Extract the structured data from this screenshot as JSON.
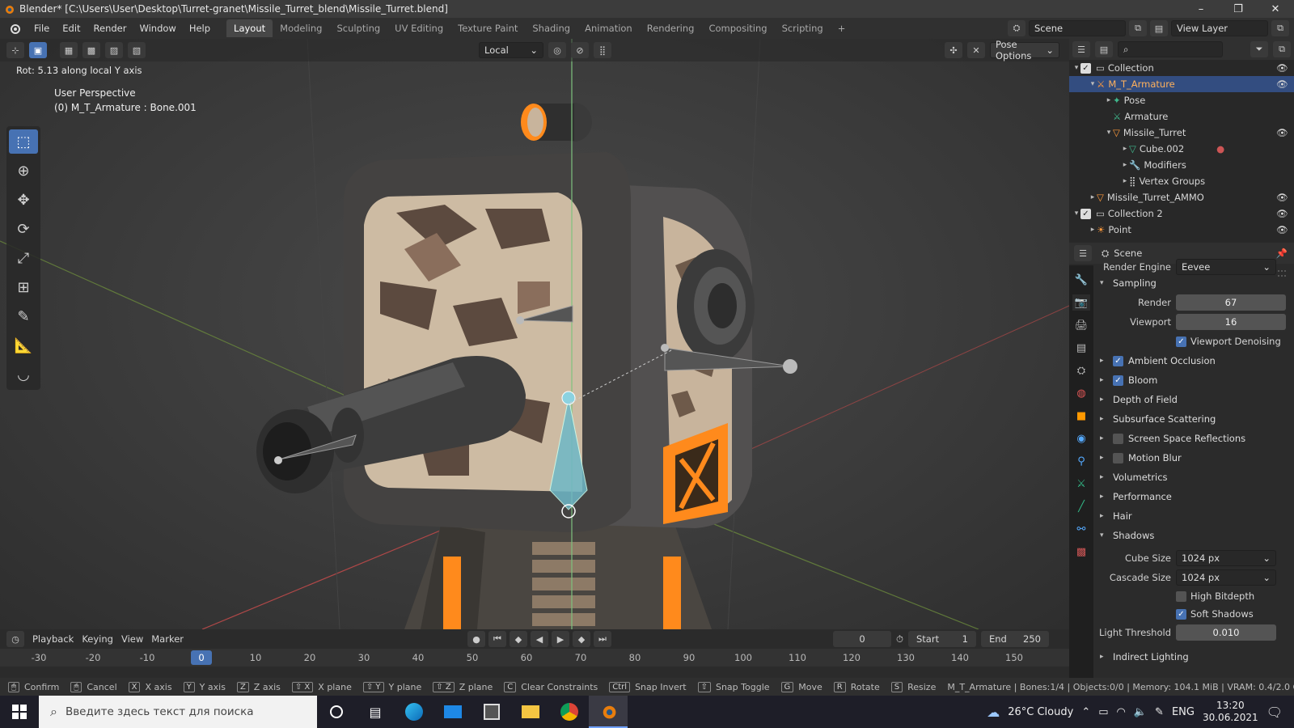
{
  "window": {
    "title": "Blender* [C:\\Users\\User\\Desktop\\Turret-granet\\Missile_Turret_blend\\Missile_Turret.blend]",
    "minimize": "–",
    "maximize": "❐",
    "close": "✕"
  },
  "menu": [
    "File",
    "Edit",
    "Render",
    "Window",
    "Help"
  ],
  "workspaces": [
    "Layout",
    "Modeling",
    "Sculpting",
    "UV Editing",
    "Texture Paint",
    "Shading",
    "Animation",
    "Rendering",
    "Compositing",
    "Scripting",
    "+"
  ],
  "scene": {
    "name": "Scene",
    "view_layer": "View Layer"
  },
  "viewport": {
    "transform_orientation": "Local",
    "pose_options": "Pose Options",
    "op_info": "Rot: 5.13 along local Y axis",
    "view_name": "User Perspective",
    "context": "(0) M_T_Armature : Bone.001"
  },
  "outliner": {
    "search_placeholder": "",
    "rows": [
      {
        "label": "Collection",
        "indent": 0
      },
      {
        "label": "M_T_Armature",
        "indent": 1
      },
      {
        "label": "Pose",
        "indent": 2
      },
      {
        "label": "Armature",
        "indent": 2
      },
      {
        "label": "Missile_Turret",
        "indent": 2
      },
      {
        "label": "Cube.002",
        "indent": 3
      },
      {
        "label": "Modifiers",
        "indent": 3
      },
      {
        "label": "Vertex Groups",
        "indent": 3
      },
      {
        "label": "Missile_Turret_AMMO",
        "indent": 1
      },
      {
        "label": "Collection 2",
        "indent": 0
      },
      {
        "label": "Point",
        "indent": 1
      }
    ]
  },
  "properties": {
    "context": "Scene",
    "render_engine_label": "Render Engine",
    "render_engine": "Eevee",
    "sampling": {
      "title": "Sampling",
      "render_label": "Render",
      "render": "67",
      "viewport_label": "Viewport",
      "viewport": "16",
      "denoise": "Viewport Denoising"
    },
    "sections": [
      {
        "label": "Ambient Occlusion",
        "checkbox": true,
        "checked": true
      },
      {
        "label": "Bloom",
        "checkbox": true,
        "checked": true
      },
      {
        "label": "Depth of Field",
        "checkbox": false
      },
      {
        "label": "Subsurface Scattering",
        "checkbox": false
      },
      {
        "label": "Screen Space Reflections",
        "checkbox": true,
        "checked": false
      },
      {
        "label": "Motion Blur",
        "checkbox": true,
        "checked": false
      },
      {
        "label": "Volumetrics",
        "checkbox": false
      },
      {
        "label": "Performance",
        "checkbox": false
      },
      {
        "label": "Hair",
        "checkbox": false
      }
    ],
    "shadows": {
      "title": "Shadows",
      "cube_label": "Cube Size",
      "cube": "1024 px",
      "cascade_label": "Cascade Size",
      "cascade": "1024 px",
      "high_bitdepth": "High Bitdepth",
      "soft_shadows": "Soft Shadows",
      "light_threshold_label": "Light Threshold",
      "light_threshold": "0.010"
    },
    "indirect": "Indirect Lighting"
  },
  "timeline": {
    "playback": "Playback",
    "keying": "Keying",
    "view": "View",
    "marker": "Marker",
    "current": "0",
    "start_label": "Start",
    "start": "1",
    "end_label": "End",
    "end": "250",
    "ticks": [
      "-30",
      "-20",
      "-10",
      "0",
      "10",
      "20",
      "30",
      "40",
      "50",
      "60",
      "70",
      "80",
      "90",
      "100",
      "110",
      "120",
      "130",
      "140",
      "150"
    ]
  },
  "status": {
    "items": [
      [
        "",
        "Confirm"
      ],
      [
        "",
        "Cancel"
      ],
      [
        "X",
        "X axis"
      ],
      [
        "Y",
        "Y axis"
      ],
      [
        "Z",
        "Z axis"
      ],
      [
        "⇧ X",
        "X plane"
      ],
      [
        "⇧ Y",
        "Y plane"
      ],
      [
        "⇧ Z",
        "Z plane"
      ],
      [
        "C",
        "Clear Constraints"
      ],
      [
        "Ctrl",
        "Snap Invert"
      ],
      [
        "⇧",
        "Snap Toggle"
      ],
      [
        "G",
        "Move"
      ],
      [
        "R",
        "Rotate"
      ],
      [
        "S",
        "Resize"
      ]
    ],
    "info": "M_T_Armature | Bones:1/4 | Objects:0/0 | Memory: 104.1 MiB | VRAM: 0.4/2.0 GiB"
  },
  "taskbar": {
    "search": "Введите здесь текст для поиска",
    "weather": "26°C  Cloudy",
    "lang": "ENG",
    "time": "13:20",
    "date": "30.06.2021"
  },
  "colors": {
    "accent": "#4772b3",
    "orange": "#ff8a1c",
    "bone": "#6fb8c7"
  }
}
